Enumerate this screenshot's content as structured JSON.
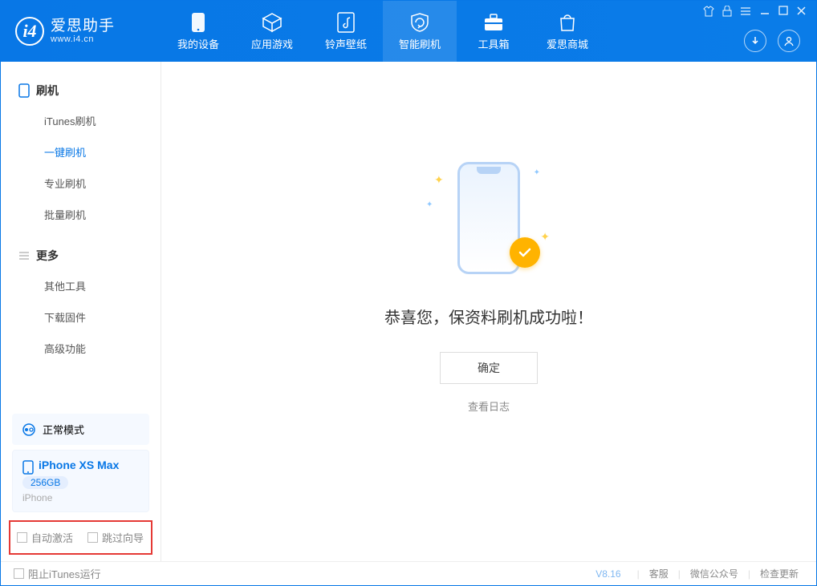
{
  "header": {
    "app_name": "爱思助手",
    "app_url": "www.i4.cn",
    "tabs": [
      {
        "label": "我的设备"
      },
      {
        "label": "应用游戏"
      },
      {
        "label": "铃声壁纸"
      },
      {
        "label": "智能刷机"
      },
      {
        "label": "工具箱"
      },
      {
        "label": "爱思商城"
      }
    ]
  },
  "sidebar": {
    "section1": {
      "title": "刷机"
    },
    "items1": [
      {
        "label": "iTunes刷机"
      },
      {
        "label": "一键刷机"
      },
      {
        "label": "专业刷机"
      },
      {
        "label": "批量刷机"
      }
    ],
    "section2": {
      "title": "更多"
    },
    "items2": [
      {
        "label": "其他工具"
      },
      {
        "label": "下载固件"
      },
      {
        "label": "高级功能"
      }
    ],
    "mode_card": {
      "label": "正常模式"
    },
    "device": {
      "name": "iPhone XS Max",
      "capacity": "256GB",
      "subtitle": "iPhone"
    },
    "checkboxes": {
      "auto_activate": "自动激活",
      "skip_guide": "跳过向导"
    }
  },
  "main": {
    "success_message": "恭喜您，保资料刷机成功啦！",
    "ok_button": "确定",
    "view_log": "查看日志"
  },
  "footer": {
    "block_itunes": "阻止iTunes运行",
    "version": "V8.16",
    "links": {
      "support": "客服",
      "wechat": "微信公众号",
      "check_update": "检查更新"
    }
  }
}
